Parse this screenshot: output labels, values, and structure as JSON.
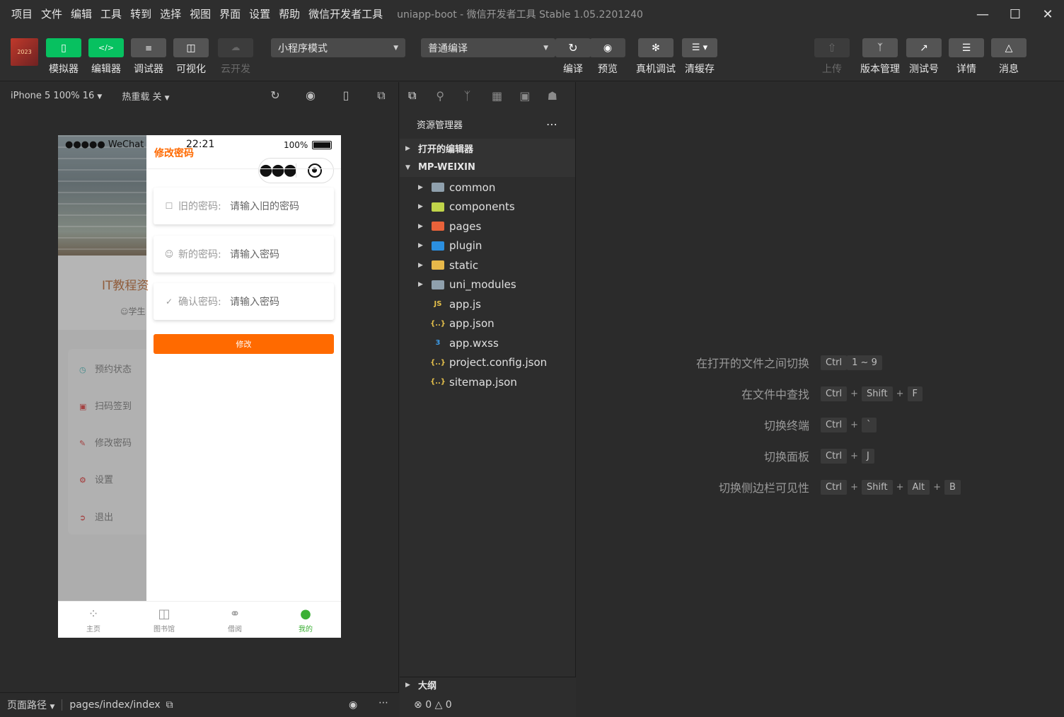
{
  "menubar": {
    "items": [
      "项目",
      "文件",
      "编辑",
      "工具",
      "转到",
      "选择",
      "视图",
      "界面",
      "设置",
      "帮助",
      "微信开发者工具"
    ],
    "title": "uniapp-boot",
    "subtitle": "- 微信开发者工具 Stable 1.05.2201240"
  },
  "toolbar": {
    "left_buttons": [
      {
        "label": "模拟器",
        "icon": "phone-icon"
      },
      {
        "label": "编辑器",
        "icon": "code-icon"
      },
      {
        "label": "调试器",
        "icon": "debug-sliders-icon"
      },
      {
        "label": "可视化",
        "icon": "layout-icon"
      },
      {
        "label": "云开发",
        "icon": "cloud-icon"
      }
    ],
    "mode_select": "小程序模式",
    "compile_select": "普通编译",
    "mid_buttons": [
      {
        "label": "编译",
        "icon": "refresh-icon"
      },
      {
        "label": "预览",
        "icon": "eye-icon"
      },
      {
        "label": "真机调试",
        "icon": "bug-icon"
      },
      {
        "label": "清缓存",
        "icon": "layers-icon"
      }
    ],
    "right_buttons": [
      {
        "label": "上传",
        "icon": "upload-icon"
      },
      {
        "label": "版本管理",
        "icon": "branch-icon"
      },
      {
        "label": "测试号",
        "icon": "external-link-icon"
      },
      {
        "label": "详情",
        "icon": "menu-icon"
      },
      {
        "label": "消息",
        "icon": "bell-icon"
      }
    ]
  },
  "simulator": {
    "device": "iPhone 5 100% 16",
    "hot_reload": "热重载 关",
    "status": {
      "carrier": "●●●●● WeChat",
      "time": "22:21",
      "battery": "100%"
    },
    "nav_title": "修改密码",
    "background_page": {
      "title": "IT教程资",
      "subtitle": "学生",
      "menu": [
        "预约状态",
        "扫码签到",
        "修改密码",
        "设置",
        "退出"
      ]
    },
    "form": {
      "old_label": "旧的密码:",
      "old_placeholder": "请输入旧的密码",
      "new_label": "新的密码:",
      "new_placeholder": "请输入密码",
      "confirm_label": "确认密码:",
      "confirm_placeholder": "请输入密码",
      "submit": "修改"
    },
    "tabs": [
      "主页",
      "图书馆",
      "借阅",
      "我的"
    ],
    "footer": {
      "route_label": "页面路径",
      "route": "pages/index/index"
    }
  },
  "explorer": {
    "title": "资源管理器",
    "open_editors": "打开的编辑器",
    "project": "MP-WEIXIN",
    "folders": [
      {
        "name": "common",
        "color": "#8fa0ad"
      },
      {
        "name": "components",
        "color": "#c0d44a"
      },
      {
        "name": "pages",
        "color": "#e8623a"
      },
      {
        "name": "plugin",
        "color": "#2b8fe0"
      },
      {
        "name": "static",
        "color": "#e7b84a"
      },
      {
        "name": "uni_modules",
        "color": "#8fa0ad"
      }
    ],
    "files": [
      {
        "name": "app.js",
        "badge": "JS",
        "color": "#e5c04b"
      },
      {
        "name": "app.json",
        "badge": "{..}",
        "color": "#e5c04b"
      },
      {
        "name": "app.wxss",
        "badge": "3",
        "color": "#3c9be8"
      },
      {
        "name": "project.config.json",
        "badge": "{..}",
        "color": "#e5c04b"
      },
      {
        "name": "sitemap.json",
        "badge": "{..}",
        "color": "#e5c04b"
      }
    ],
    "outline": "大纲",
    "errors": "0",
    "warnings": "0"
  },
  "shortcuts": [
    {
      "name": "在打开的文件之间切换",
      "keys": [
        "Ctrl",
        "1 ~ 9"
      ]
    },
    {
      "name": "在文件中查找",
      "keys": [
        "Ctrl",
        "+",
        "Shift",
        "+",
        "F"
      ]
    },
    {
      "name": "切换终端",
      "keys": [
        "Ctrl",
        "+",
        "`"
      ]
    },
    {
      "name": "切换面板",
      "keys": [
        "Ctrl",
        "+",
        "J"
      ]
    },
    {
      "name": "切换侧边栏可见性",
      "keys": [
        "Ctrl",
        "+",
        "Shift",
        "+",
        "Alt",
        "+",
        "B"
      ]
    }
  ]
}
